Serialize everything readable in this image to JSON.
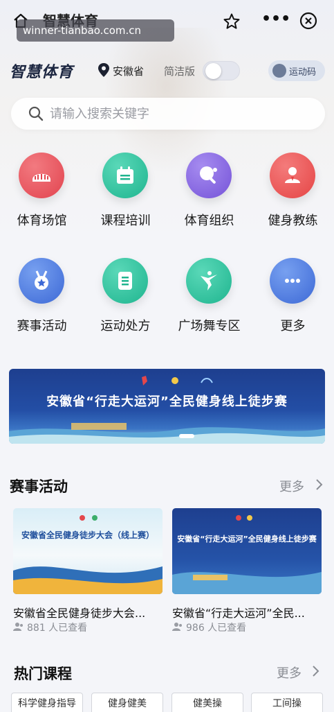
{
  "titlebar": {
    "title": "智慧体育",
    "watermark": "winner-tianbao.com.cn",
    "icons": [
      "home-icon",
      "star-icon",
      "more-icon",
      "close-icon"
    ],
    "more_glyph": "•••"
  },
  "brand": {
    "logo_text": "智慧体育",
    "location": "安徽省",
    "simple_mode_label": "简洁版",
    "simple_mode_on": false,
    "sport_code_label": "运动码"
  },
  "search": {
    "placeholder": "请输入搜索关键字"
  },
  "grid": [
    {
      "label": "体育场馆",
      "color": "#ea5a63",
      "icon": "stadium-icon"
    },
    {
      "label": "课程培训",
      "color": "#2fc3a0",
      "icon": "calendar-icon"
    },
    {
      "label": "体育组织",
      "color": "#8b6fe0",
      "icon": "table-tennis-icon"
    },
    {
      "label": "健身教练",
      "color": "#ef5a5a",
      "icon": "coach-icon"
    },
    {
      "label": "赛事活动",
      "color": "#4a78de",
      "icon": "medal-icon"
    },
    {
      "label": "运动处方",
      "color": "#2fc3a0",
      "icon": "prescription-icon"
    },
    {
      "label": "广场舞专区",
      "color": "#2fc3a0",
      "icon": "dancer-icon"
    },
    {
      "label": "更多",
      "color": "#4a78de",
      "icon": "more-icon"
    }
  ],
  "banner": {
    "title": "安徽省“行走大运河”全民健身线上徒步赛"
  },
  "events_section": {
    "title": "赛事活动",
    "more": "更多",
    "cards": [
      {
        "title": "安徽省全民健身徒步大会...",
        "views": "881 人已查看",
        "poster_title": "安徽省全民健身徒步大会（线上赛）"
      },
      {
        "title": "安徽省“行走大运河”全民...",
        "views": "986 人已查看",
        "poster_title": "安徽省“行走大运河”全民健身线上徒步赛"
      }
    ]
  },
  "courses_section": {
    "title": "热门课程",
    "more": "更多",
    "tabs": [
      "科学健身指导",
      "健身健美",
      "健美操",
      "工间操"
    ]
  }
}
